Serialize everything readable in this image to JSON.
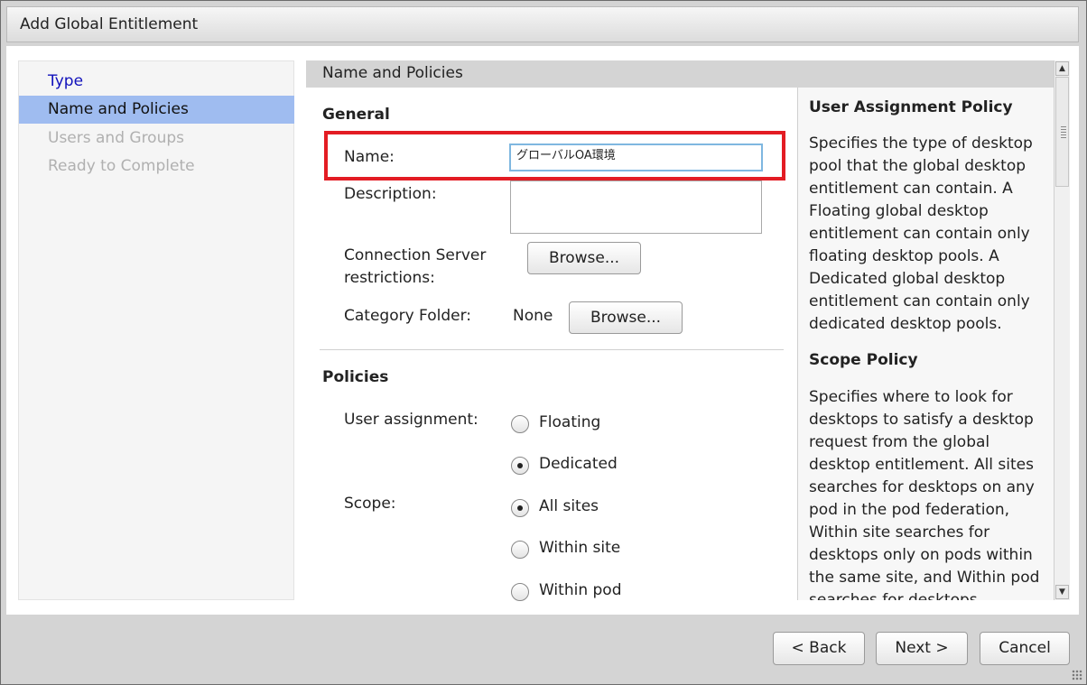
{
  "dialog": {
    "title": "Add Global Entitlement"
  },
  "nav": {
    "items": [
      {
        "label": "Type",
        "state": "link"
      },
      {
        "label": "Name and Policies",
        "state": "active"
      },
      {
        "label": "Users and Groups",
        "state": "disabled"
      },
      {
        "label": "Ready to Complete",
        "state": "disabled"
      }
    ]
  },
  "form": {
    "header": "Name and Policies",
    "general_heading": "General",
    "name_label": "Name:",
    "name_value": "グローバルOA環境",
    "description_label": "Description:",
    "description_value": "",
    "connection_server_label_line1": "Connection Server",
    "connection_server_label_line2": "restrictions:",
    "browse_label": "Browse...",
    "category_folder_label": "Category Folder:",
    "category_folder_value": "None",
    "policies_heading": "Policies",
    "user_assignment_label": "User assignment:",
    "user_assignment_options": [
      {
        "label": "Floating",
        "checked": false
      },
      {
        "label": "Dedicated",
        "checked": true
      }
    ],
    "scope_label": "Scope:",
    "scope_options": [
      {
        "label": "All sites",
        "checked": true
      },
      {
        "label": "Within site",
        "checked": false
      },
      {
        "label": "Within pod",
        "checked": false
      }
    ]
  },
  "help": {
    "user_assignment_title": "User Assignment Policy",
    "user_assignment_text": "Specifies the type of desktop pool that the global desktop entitlement can contain. A Floating global desktop entitlement can contain only floating desktop pools. A Dedicated global desktop entitlement can contain only dedicated desktop pools.",
    "scope_title": "Scope Policy",
    "scope_text": "Specifies where to look for desktops to satisfy a desktop request from the global desktop entitlement. All sites searches for desktops on any pod in the pod federation, Within site searches for desktops only on pods within the same site, and Within pod searches for desktops"
  },
  "footer": {
    "back_label": "< Back",
    "next_label": "Next >",
    "cancel_label": "Cancel"
  },
  "colors": {
    "active_nav": "#9fbcf0",
    "highlight": "#e31c23",
    "link": "#1111bb"
  }
}
